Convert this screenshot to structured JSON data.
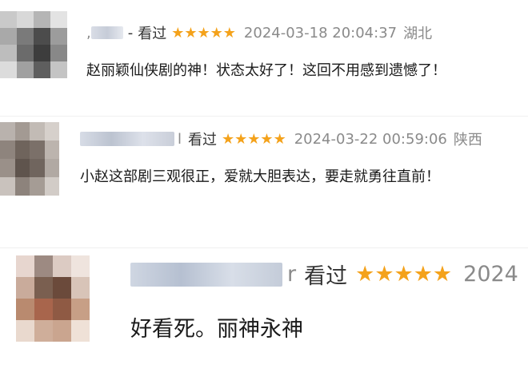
{
  "comments": [
    {
      "prefix": ", ",
      "dash": "-",
      "watched": "看过",
      "stars": "★★★★★",
      "datetime": "2024-03-18 20:04:37",
      "location": "湖北",
      "text": "赵丽颖仙侠剧的神！状态太好了！这回不用感到遗憾了！",
      "avatar_colors": [
        "#c9c9c9",
        "#d8d8d8",
        "#b5b5b5",
        "#e3e3e3",
        "#a9a9a9",
        "#7a7a7a",
        "#4c4c4c",
        "#9c9c9c",
        "#bdbdbd",
        "#6b6b6b",
        "#3d3d3d",
        "#888888",
        "#dcdcdc",
        "#a0a0a0",
        "#5e5e5e",
        "#c4c4c4"
      ]
    },
    {
      "suffix": "l",
      "watched": "看过",
      "stars": "★★★★★",
      "datetime": "2024-03-22 00:59:06",
      "location": "陕西",
      "text": "小赵这部剧三观很正，爱就大胆表达，要走就勇往直前！",
      "avatar_colors": [
        "#b9b2ad",
        "#a39a93",
        "#c2bbb5",
        "#d6d0cb",
        "#8e847d",
        "#6f645c",
        "#7b7069",
        "#bcb4ae",
        "#9a9089",
        "#5f544d",
        "#70655e",
        "#b1a9a3",
        "#c9c2bd",
        "#8d837c",
        "#a59c95",
        "#d2ccc7"
      ]
    },
    {
      "suffix": "r",
      "watched": "看过",
      "stars": "★★★★★",
      "datetime": "2024",
      "text": "好看死。丽神永神",
      "avatar_colors": [
        "#e7d6cf",
        "#9d8a82",
        "#dccbc3",
        "#efe4de",
        "#c9ab9b",
        "#7a5f50",
        "#6b4a3b",
        "#d8c4b8",
        "#b98a6f",
        "#a8654c",
        "#8f5a44",
        "#c79f86",
        "#e9d9ce",
        "#cfae9a",
        "#caa58f",
        "#efe1d7"
      ]
    }
  ]
}
